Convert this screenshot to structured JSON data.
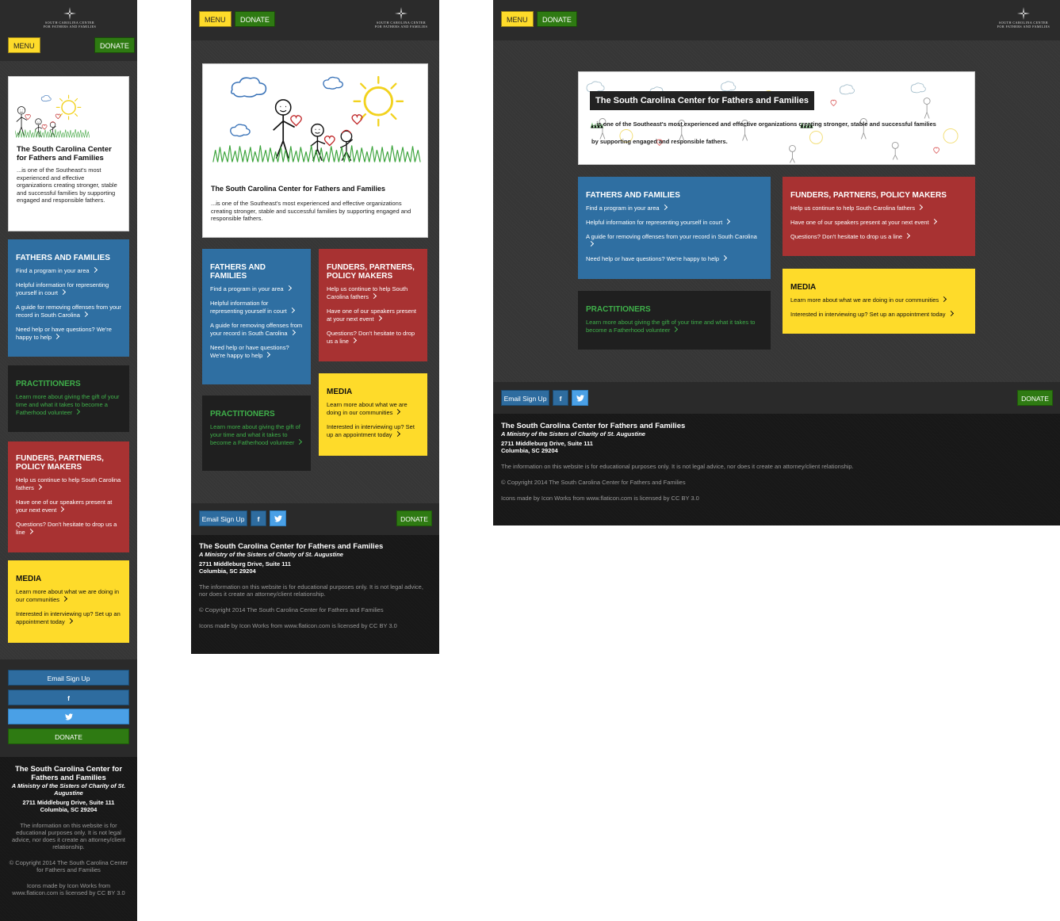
{
  "site": {
    "logo_line1": "SOUTH CAROLINA CENTER",
    "logo_line2": "FOR FATHERS AND FAMILIES",
    "menu_label": "MENU",
    "donate_label": "DONATE"
  },
  "hero": {
    "title": "The South Carolina Center for Fathers and Families",
    "tagline": "...is one of the Southeast's most experienced and effective organizations creating stronger, stable and successful families by supporting engaged and responsible fathers."
  },
  "tiles": {
    "fathers": {
      "title": "FATHERS AND FAMILIES",
      "links": [
        "Find a program in your area",
        "Helpful information for representing yourself in court",
        "A guide for removing offenses from your record in South Carolina",
        "Need help or have questions? We're happy to help"
      ]
    },
    "practitioners": {
      "title": "PRACTITIONERS",
      "links": [
        "Learn more about giving the gift of your time and what it takes to become a Fatherhood volunteer"
      ]
    },
    "funders": {
      "title": "FUNDERS, PARTNERS, POLICY MAKERS",
      "links": [
        "Help us continue to help South Carolina fathers",
        "Have one of our speakers present at your next event",
        "Questions? Don't hesitate to drop us a line"
      ]
    },
    "media": {
      "title": "MEDIA",
      "links": [
        "Learn more about what we are doing in our communities",
        "Interested in interviewing up? Set up an appointment today"
      ]
    }
  },
  "social": {
    "email_label": "Email Sign Up",
    "facebook_glyph": "f",
    "twitter_icon": "twitter-bird",
    "donate_label": "DONATE"
  },
  "footer": {
    "org": "The South Carolina Center for Fathers and Families",
    "ministry": "A Ministry of the Sisters of Charity of St. Augustine",
    "address1": "2711 Middleburg Drive, Suite 111",
    "address2": "Columbia, SC 29204",
    "disclaimer": "The information on this website is for educational purposes only. It is not legal advice, nor does it create an attorney/client relationship.",
    "copyright": "© Copyright 2014 The South Carolina Center for Fathers and Families",
    "credits": "Icons made by Icon Works from www.flaticon.com is licensed by CC BY 3.0"
  },
  "colors": {
    "blue": "#2f6fa2",
    "red": "#a83232",
    "yellow": "#fedb2a",
    "green": "#2e7a12",
    "practitioner_green": "#3fb04a"
  }
}
